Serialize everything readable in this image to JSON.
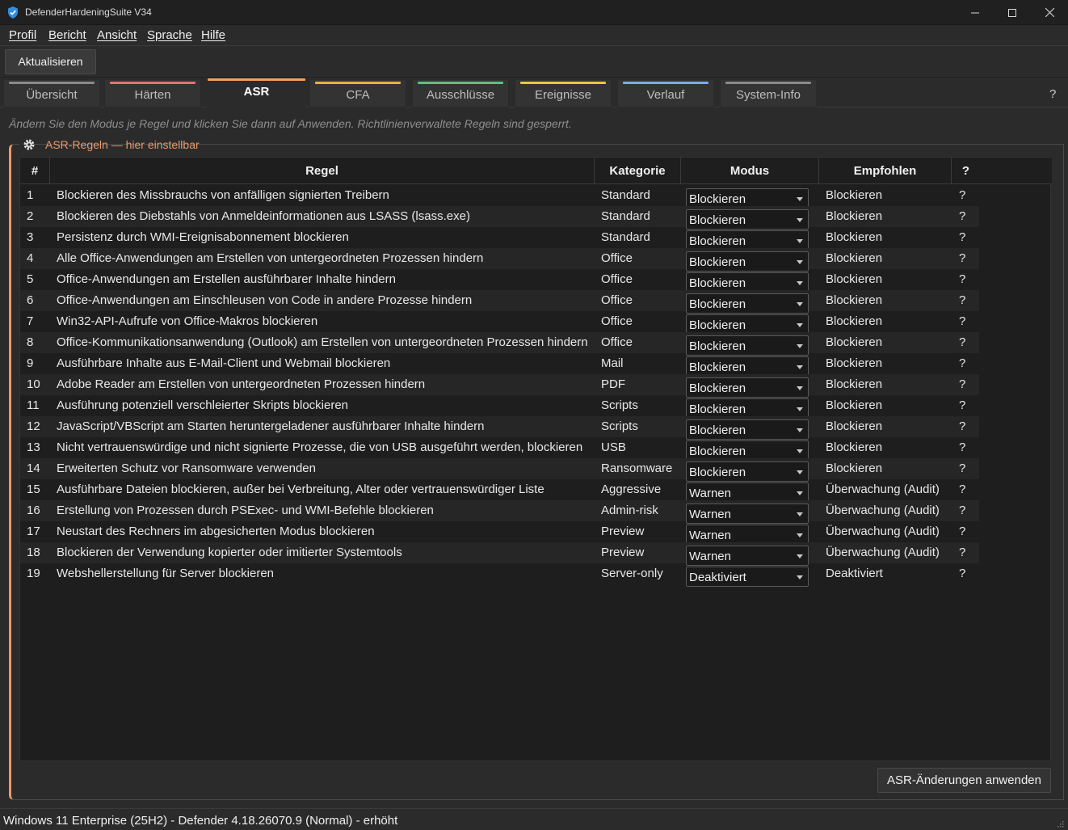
{
  "window": {
    "title": "DefenderHardeningSuite V34"
  },
  "menu": {
    "items": [
      "Profil",
      "Bericht",
      "Ansicht",
      "Sprache",
      "Hilfe"
    ]
  },
  "toolbar": {
    "refresh_label": "Aktualisieren"
  },
  "tabs": [
    {
      "label": "Übersicht",
      "accent": "#8a8a8a",
      "active": false
    },
    {
      "label": "Härten",
      "accent": "#e57373",
      "active": false
    },
    {
      "label": "ASR",
      "accent": "#f0a060",
      "active": true
    },
    {
      "label": "CFA",
      "accent": "#e8b040",
      "active": false
    },
    {
      "label": "Ausschlüsse",
      "accent": "#5fbf7f",
      "active": false
    },
    {
      "label": "Ereignisse",
      "accent": "#e8c840",
      "active": false
    },
    {
      "label": "Verlauf",
      "accent": "#7ea8f0",
      "active": false
    },
    {
      "label": "System-Info",
      "accent": "#8a8a8a",
      "active": false
    }
  ],
  "tabs_help": "?",
  "hint": "Ändern Sie den Modus je Regel und klicken Sie dann auf Anwenden. Richtlinienverwaltete Regeln sind gesperrt.",
  "group": {
    "title": "ASR-Regeln — hier einstellbar"
  },
  "table": {
    "headers": {
      "num": "#",
      "rule": "Regel",
      "category": "Kategorie",
      "mode": "Modus",
      "recommended": "Empfohlen",
      "help": "?"
    },
    "rows": [
      {
        "num": "1",
        "rule": "Blockieren des Missbrauchs von anfälligen signierten Treibern",
        "category": "Standard",
        "mode": "Blockieren",
        "recommended": "Blockieren",
        "help": "?"
      },
      {
        "num": "2",
        "rule": "Blockieren des Diebstahls von Anmeldeinformationen aus LSASS (lsass.exe)",
        "category": "Standard",
        "mode": "Blockieren",
        "recommended": "Blockieren",
        "help": "?"
      },
      {
        "num": "3",
        "rule": "Persistenz durch WMI-Ereignisabonnement blockieren",
        "category": "Standard",
        "mode": "Blockieren",
        "recommended": "Blockieren",
        "help": "?"
      },
      {
        "num": "4",
        "rule": "Alle Office-Anwendungen am Erstellen von untergeordneten Prozessen hindern",
        "category": "Office",
        "mode": "Blockieren",
        "recommended": "Blockieren",
        "help": "?"
      },
      {
        "num": "5",
        "rule": "Office-Anwendungen am Erstellen ausführbarer Inhalte hindern",
        "category": "Office",
        "mode": "Blockieren",
        "recommended": "Blockieren",
        "help": "?"
      },
      {
        "num": "6",
        "rule": "Office-Anwendungen am Einschleusen von Code in andere Prozesse hindern",
        "category": "Office",
        "mode": "Blockieren",
        "recommended": "Blockieren",
        "help": "?"
      },
      {
        "num": "7",
        "rule": "Win32-API-Aufrufe von Office-Makros blockieren",
        "category": "Office",
        "mode": "Blockieren",
        "recommended": "Blockieren",
        "help": "?"
      },
      {
        "num": "8",
        "rule": "Office-Kommunikationsanwendung (Outlook) am Erstellen von untergeordneten Prozessen hindern",
        "category": "Office",
        "mode": "Blockieren",
        "recommended": "Blockieren",
        "help": "?"
      },
      {
        "num": "9",
        "rule": "Ausführbare Inhalte aus E-Mail-Client und Webmail blockieren",
        "category": "Mail",
        "mode": "Blockieren",
        "recommended": "Blockieren",
        "help": "?"
      },
      {
        "num": "10",
        "rule": "Adobe Reader am Erstellen von untergeordneten Prozessen hindern",
        "category": "PDF",
        "mode": "Blockieren",
        "recommended": "Blockieren",
        "help": "?"
      },
      {
        "num": "11",
        "rule": "Ausführung potenziell verschleierter Skripts blockieren",
        "category": "Scripts",
        "mode": "Blockieren",
        "recommended": "Blockieren",
        "help": "?"
      },
      {
        "num": "12",
        "rule": "JavaScript/VBScript am Starten heruntergeladener ausführbarer Inhalte hindern",
        "category": "Scripts",
        "mode": "Blockieren",
        "recommended": "Blockieren",
        "help": "?"
      },
      {
        "num": "13",
        "rule": "Nicht vertrauenswürdige und nicht signierte Prozesse, die von USB ausgeführt werden, blockieren",
        "category": "USB",
        "mode": "Blockieren",
        "recommended": "Blockieren",
        "help": "?"
      },
      {
        "num": "14",
        "rule": "Erweiterten Schutz vor Ransomware verwenden",
        "category": "Ransomware",
        "mode": "Blockieren",
        "recommended": "Blockieren",
        "help": "?"
      },
      {
        "num": "15",
        "rule": "Ausführbare Dateien blockieren, außer bei Verbreitung, Alter oder vertrauenswürdiger Liste",
        "category": "Aggressive",
        "mode": "Warnen",
        "recommended": "Überwachung (Audit)",
        "help": "?"
      },
      {
        "num": "16",
        "rule": "Erstellung von Prozessen durch PSExec- und WMI-Befehle blockieren",
        "category": "Admin-risk",
        "mode": "Warnen",
        "recommended": "Überwachung (Audit)",
        "help": "?"
      },
      {
        "num": "17",
        "rule": "Neustart des Rechners im abgesicherten Modus blockieren",
        "category": "Preview",
        "mode": "Warnen",
        "recommended": "Überwachung (Audit)",
        "help": "?"
      },
      {
        "num": "18",
        "rule": "Blockieren der Verwendung kopierter oder imitierter Systemtools",
        "category": "Preview",
        "mode": "Warnen",
        "recommended": "Überwachung (Audit)",
        "help": "?"
      },
      {
        "num": "19",
        "rule": "Webshellerstellung für Server blockieren",
        "category": "Server-only",
        "mode": "Deaktiviert",
        "recommended": "Deaktiviert",
        "help": "?"
      }
    ]
  },
  "apply_button": "ASR-Änderungen anwenden",
  "status": "Windows 11 Enterprise (25H2) - Defender 4.18.26070.9 (Normal) - erhöht"
}
